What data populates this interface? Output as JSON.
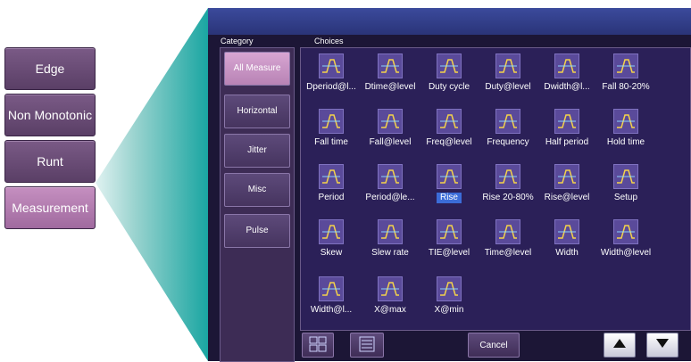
{
  "left_menu": {
    "items": [
      {
        "label": "Edge"
      },
      {
        "label": "Non Monotonic"
      },
      {
        "label": "Runt"
      },
      {
        "label": "Measurement"
      }
    ]
  },
  "panel": {
    "category_header": "Category",
    "choices_header": "Choices",
    "categories": [
      {
        "label": "All Measure"
      },
      {
        "label": "Horizontal"
      },
      {
        "label": "Jitter"
      },
      {
        "label": "Misc"
      },
      {
        "label": "Pulse"
      }
    ],
    "choices": [
      "Dperiod@l...",
      "Dtime@level",
      "Duty cycle",
      "Duty@level",
      "Dwidth@l...",
      "Fall 80-20%",
      "Fall time",
      "Fall@level",
      "Freq@level",
      "Frequency",
      "Half period",
      "Hold time",
      "Period",
      "Period@le...",
      "Rise",
      "Rise 20-80%",
      "Rise@level",
      "Setup",
      "Skew",
      "Slew rate",
      "TIE@level",
      "Time@level",
      "Width",
      "Width@level",
      "Width@l...",
      "X@max",
      "X@min"
    ],
    "selected_choice": "Rise",
    "cancel_label": "Cancel"
  },
  "colors": {
    "accent_selected": "#3b6cd8",
    "teal_wedge": "#1aa6a2",
    "panel_bg": "#1c1636"
  },
  "icons": {
    "left_icon": "grid-icon",
    "right_icon": "list-icon",
    "up": "triangle-up-icon",
    "down": "triangle-down-icon"
  }
}
